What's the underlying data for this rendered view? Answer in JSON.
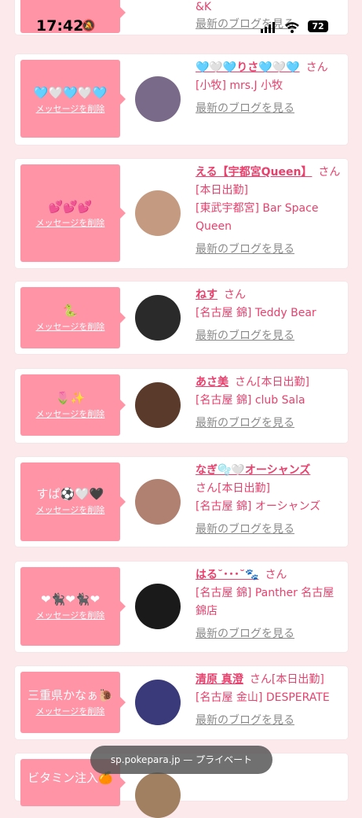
{
  "status_bar": {
    "time": "17:42",
    "battery": "72"
  },
  "top_partial": {
    "name_tail": "&K",
    "blog_link": "最新のブログを見る"
  },
  "cards": [
    {
      "message": "🩵🤍🩵🤍🩵",
      "delete_label": "メッセージを削除",
      "name": "🩵🤍🩵りさ🩵🤍🩵",
      "san": "さん",
      "work_status": "",
      "shop": "[小牧] mrs.J 小牧",
      "blog_link": "最新のブログを見る",
      "avatar_color": "#7a6a8a"
    },
    {
      "message": "💕💕💕",
      "delete_label": "メッセージを削除",
      "name": "える【宇都宮Queen】",
      "san": "さん",
      "work_status": "[本日出勤]",
      "shop": "[東武宇都宮] Bar Space Queen",
      "blog_link": "最新のブログを見る",
      "avatar_color": "#c49a80"
    },
    {
      "message": "🐍",
      "delete_label": "メッセージを削除",
      "name": "ねす",
      "san": "さん",
      "work_status": "",
      "shop": "[名古屋 錦] Teddy Bear",
      "blog_link": "最新のブログを見る",
      "avatar_color": "#2a2a2a"
    },
    {
      "message": "🌷✨",
      "delete_label": "メッセージを削除",
      "name": "あさ美",
      "san": "さん",
      "work_status": "[本日出勤]",
      "shop": "[名古屋 錦] club Sala",
      "blog_link": "最新のブログを見る",
      "avatar_color": "#5a3a2a"
    },
    {
      "message": "すぱ⚽️🤍🖤",
      "delete_label": "メッセージを削除",
      "name": "なぎ🫧🤍オーシャンズ",
      "san": "さん",
      "work_status": "[本日出勤]",
      "shop": "[名古屋 錦] オーシャンズ",
      "blog_link": "最新のブログを見る",
      "avatar_color": "#b08070"
    },
    {
      "message": "❤🐈‍⬛❤🐈‍⬛❤",
      "delete_label": "メッセージを削除",
      "name": "はる˘･･･˘🐾",
      "san": "さん",
      "work_status": "",
      "shop": "[名古屋 錦] Panther 名古屋錦店",
      "blog_link": "最新のブログを見る",
      "avatar_color": "#1a1a1a"
    },
    {
      "message": "三重県かなぁ🐌",
      "delete_label": "メッセージを削除",
      "name": "清原 真澄",
      "san": "さん",
      "work_status": "[本日出勤]",
      "shop": "[名古屋 金山] DESPERATE",
      "blog_link": "最新のブログを見る",
      "avatar_color": "#3a3a7a"
    },
    {
      "message": "ビタミン注入🍊",
      "delete_label": "",
      "name": "",
      "san": "",
      "work_status": "",
      "shop": "",
      "blog_link": "",
      "avatar_color": "#a08060"
    }
  ],
  "url_bar": {
    "url": "sp.pokepara.jp — プライベート"
  }
}
